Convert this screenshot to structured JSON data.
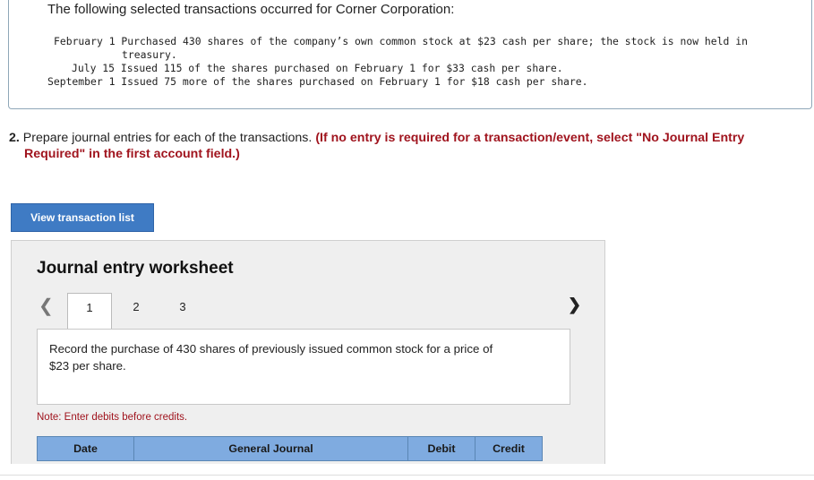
{
  "intro": {
    "title": "The following selected transactions occurred for Corner Corporation:",
    "transactions": [
      {
        "line1": "February 1 Purchased 430 shares of the company’s own common stock at $23 cash per share; the stock is now held in",
        "line2": "treasury."
      },
      {
        "line1": "July 15 Issued 115 of the shares purchased on February 1 for $33 cash per share."
      },
      {
        "line1": "September 1 Issued 75 more of the shares purchased on February 1 for $18 cash per share."
      }
    ]
  },
  "question": {
    "number": "2.",
    "text": "Prepare journal entries for each of the transactions.",
    "instruction_line1": "(If no entry is required for a transaction/event, select \"No Journal Entry",
    "instruction_line2": "Required\" in the first account field.)"
  },
  "view_button": {
    "label": "View transaction list"
  },
  "worksheet": {
    "title": "Journal entry worksheet",
    "tabs": [
      "1",
      "2",
      "3"
    ],
    "active_tab": "1",
    "description": "Record the purchase of 430 shares of previously issued common stock for a price of $23 per share.",
    "note": "Note: Enter debits before credits.",
    "columns": {
      "date": "Date",
      "general_journal": "General Journal",
      "debit": "Debit",
      "credit": "Credit"
    }
  }
}
